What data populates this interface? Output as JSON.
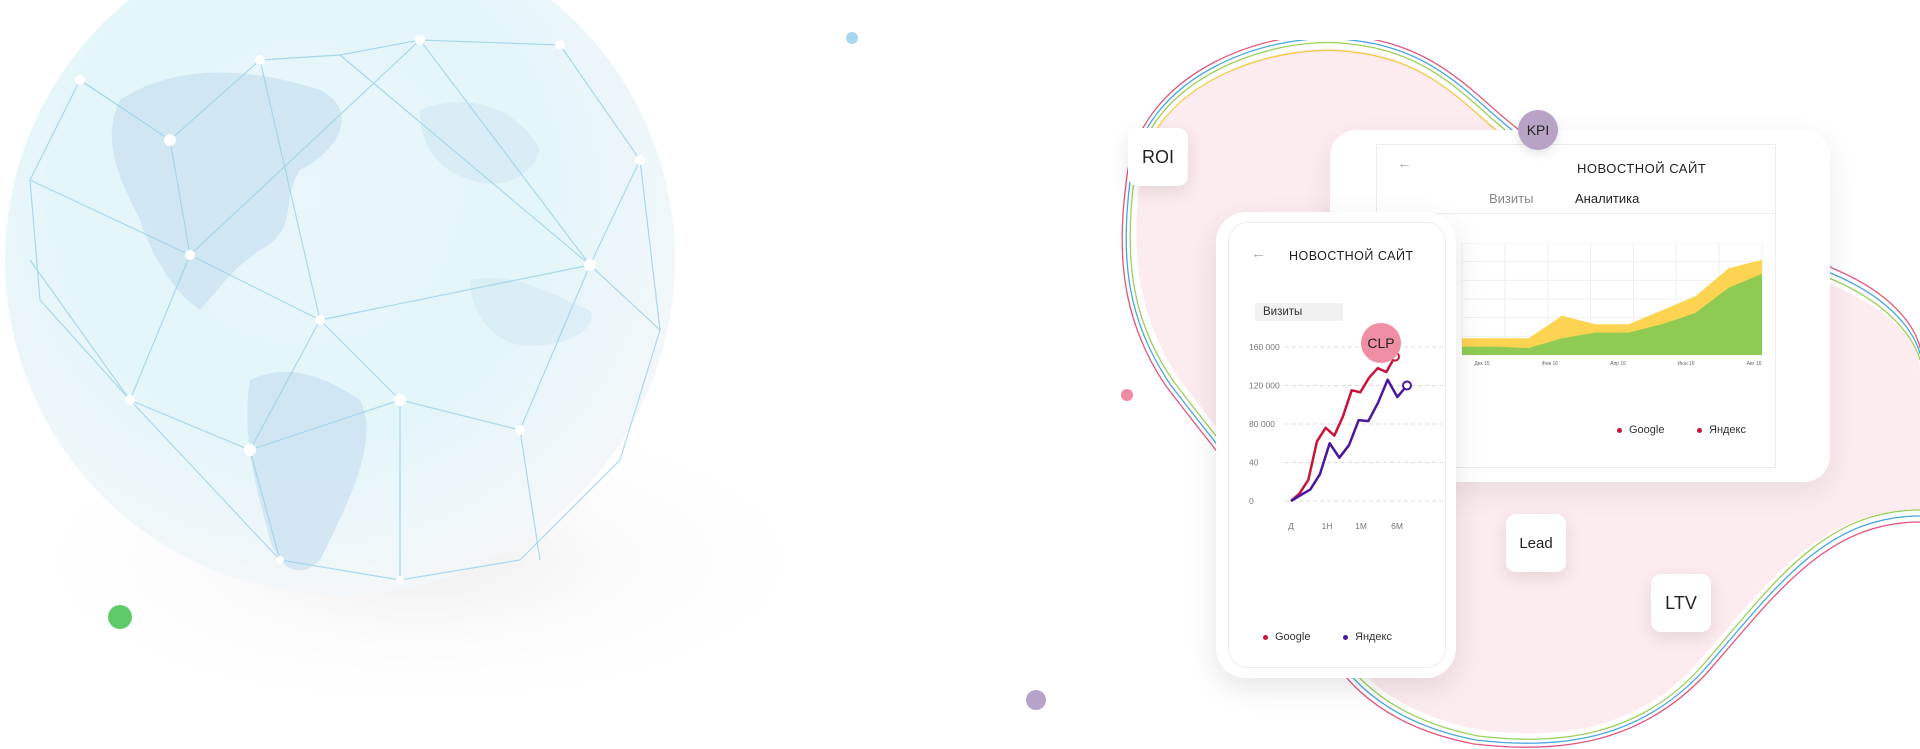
{
  "badges": {
    "roi": "ROI",
    "kpi": "KPI",
    "clp": "CLP",
    "lead": "Lead",
    "ltv": "LTV"
  },
  "tablet": {
    "back_icon": "arrow-left-icon",
    "title": "НОВОСТНОЙ САЙТ",
    "tabs": [
      "Визиты",
      "Аналитика"
    ],
    "legend": [
      "Google",
      "Яндекс"
    ],
    "x_ticks": [
      "Дек 15",
      "Фев 16",
      "Апр 16",
      "Июн 16",
      "Авг 16"
    ]
  },
  "phone": {
    "back_icon": "arrow-left-icon",
    "title": "НОВОСТНОЙ САЙТ",
    "tab": "Визиты",
    "legend": [
      "Google",
      "Яндекс"
    ]
  },
  "colors": {
    "google": "#c8133a",
    "yandex": "#4b169e",
    "area_green": "#8fcb53",
    "area_yellow": "#fcd452",
    "blob_pink": "#fdecef",
    "dot_green": "#5ecb6b",
    "dot_purple": "#b7a3c9",
    "dot_pink": "#ee8aa1",
    "dot_blue": "#a8d7f2"
  },
  "chart_data": [
    {
      "type": "line",
      "x": [
        "Д",
        "1Н",
        "1М",
        "6М"
      ],
      "y_ticks": [
        "0",
        "40",
        "80 000",
        "120 000",
        "160 000"
      ],
      "ylim": [
        0,
        160000
      ],
      "series": [
        {
          "name": "Google",
          "values": [
            0,
            8000,
            22000,
            62000,
            76000,
            68000,
            88000,
            115000,
            113000,
            128000,
            138000,
            134000,
            150000
          ]
        },
        {
          "name": "Яндекс",
          "values": [
            0,
            6000,
            12000,
            28000,
            60000,
            45000,
            58000,
            84000,
            83000,
            102000,
            126000,
            108000,
            120000
          ]
        }
      ]
    },
    {
      "type": "area",
      "x": [
        "Дек 15",
        "Фев 16",
        "Апр 16",
        "Июн 16",
        "Авг 16"
      ],
      "series": [
        {
          "name": "Google",
          "values": [
            12,
            12,
            12,
            28,
            22,
            22,
            32,
            42,
            62,
            68
          ]
        },
        {
          "name": "Яндекс",
          "values": [
            6,
            6,
            5,
            12,
            16,
            16,
            22,
            30,
            48,
            58
          ]
        }
      ]
    }
  ]
}
